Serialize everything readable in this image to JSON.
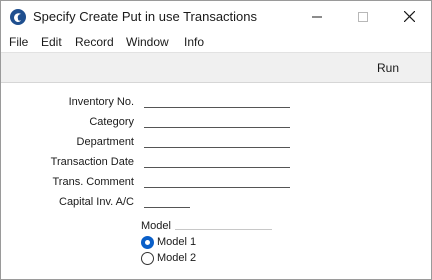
{
  "window": {
    "title": "Specify Create Put in use Transactions",
    "icon": "app-logo-icon"
  },
  "menubar": {
    "items": [
      "File",
      "Edit",
      "Record",
      "Window",
      "Info"
    ]
  },
  "toolbar": {
    "run_label": "Run"
  },
  "form": {
    "fields": [
      {
        "label": "Inventory No.",
        "value": ""
      },
      {
        "label": "Category",
        "value": ""
      },
      {
        "label": "Department",
        "value": ""
      },
      {
        "label": "Transaction Date",
        "value": ""
      },
      {
        "label": "Trans. Comment",
        "value": ""
      },
      {
        "label": "Capital Inv. A/C",
        "value": ""
      }
    ],
    "model_group": {
      "label": "Model",
      "options": [
        {
          "label": "Model 1",
          "selected": true
        },
        {
          "label": "Model 2",
          "selected": false
        }
      ]
    }
  },
  "colors": {
    "accent": "#0a5fc8",
    "field_line": "#555555"
  }
}
